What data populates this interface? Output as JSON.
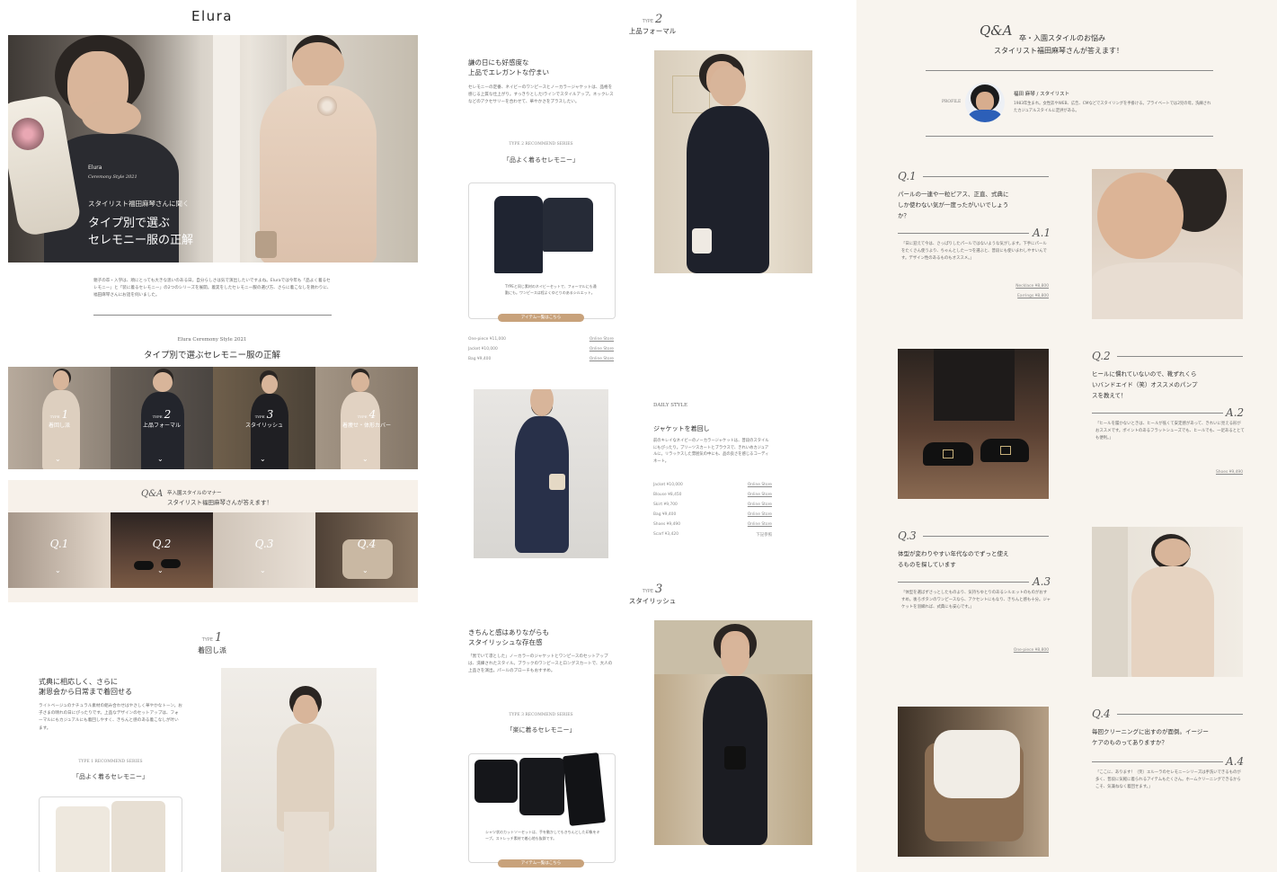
{
  "brand": {
    "logo": "Elura"
  },
  "hero": {
    "overlay_brand": "Elura",
    "overlay_sub": "Ceremony Style 2021",
    "overlay_kicker": "スタイリスト福田麻琴さんに聞く",
    "overlay_title_line1": "タイプ別で選ぶ",
    "overlay_title_line2": "セレモニー服の正解"
  },
  "intro_text": "親子の卒・入学は、頑にとっても大きな思いのある日。自分らしさは気で演出したいですよね。Eluraでは今年も「品よく着るセレモニー」と「装に着るセレモニー」の2つのシリーズを展開。着実をしたセレモニー服の選び方、さらに着こなしを教わりに、福田麻琴さんにお話を伺いました。",
  "section_en": "Elura Ceremony Style 2021",
  "section_title": "タイプ別で選ぶセレモニー服の正解",
  "type_tiles": [
    {
      "prefix": "TYPE",
      "num": "1",
      "label": "着回し派"
    },
    {
      "prefix": "TYPE",
      "num": "2",
      "label": "上品フォーマル"
    },
    {
      "prefix": "TYPE",
      "num": "3",
      "label": "スタイリッシュ"
    },
    {
      "prefix": "TYPE",
      "num": "4",
      "label": "着痩せ・体形カバー"
    }
  ],
  "qa_banner": {
    "logo": "Q&A",
    "line1": "卒入園スタイルのマナー",
    "line2": "スタイリスト福田麻琴さんが答えます！"
  },
  "qa_tiles": [
    "Q.1",
    "Q.2",
    "Q.3",
    "Q.4"
  ],
  "type1": {
    "prefix": "TYPE",
    "num": "1",
    "title": "着回し派",
    "heading1": "式典に相応しく、さらに",
    "heading2": "謝恩会から日常まで着回せる",
    "body": "ライトベージュのナチュラル素材の組み合わせはやさしく華やかなトーン。お子さまの晴れの日にぴったりです。上品なデザインのセットアップは、フォーマルにもカジュアルにも着回しやすく、きちんと感のある着こなしが叶います。",
    "recommend": "TYPE 1 RECOMMEND SERIES",
    "series": "「品よく着るセレモニー」"
  },
  "type2": {
    "prefix": "TYPE",
    "num": "2",
    "title": "上品フォーマル",
    "heading1": "謙の日にも好感度な",
    "heading2": "上品でエレガントな佇まい",
    "body": "セレモニーの定番、ネイビーのワンピースとノーカラージャケットは、品格を感じる上質な仕上がり。すっきりとしたIラインでスタイルアップ。ネックレスなどのアクセサリーを合わせて、華やかさをプラスしたい。",
    "recommend": "TYPE 2 RECOMMEND SERIES",
    "series": "「品よく着るセレモニー」",
    "product_caption": "TYPEと同じ素材のネイビーセットで、フォーマルにも通勤にも。ワンピースは程よくゆとりのあるシルエット。",
    "cta": "アイテム一覧はこちら",
    "items": [
      {
        "name": "One-piece ¥11,000",
        "link": "Online Store"
      },
      {
        "name": "Jacket ¥10,000",
        "link": "Online Store"
      },
      {
        "name": "Bag ¥9,400",
        "link": "Online Store"
      }
    ],
    "daily_en": "DAILY STYLE",
    "daily_title": "ジャケットを着回し",
    "daily_body": "前のキレイなネイビーのノーカラージャケットは、普段のスタイルにもぴったり。プリーツスカートとブラウスで、きれいめカジュアルに。リラックスした雰囲気の中にも、品の良さを感じるコーディネート。",
    "daily_items": [
      {
        "name": "Jacket ¥10,000",
        "link": "Online Store"
      },
      {
        "name": "Blouse ¥8,450",
        "link": "Online Store"
      },
      {
        "name": "Skirt ¥9,700",
        "link": "Online Store"
      },
      {
        "name": "Bag ¥9,400",
        "link": "Online Store"
      },
      {
        "name": "Shoes ¥9,490",
        "link": "Online Store"
      },
      {
        "name": "Scarf ¥3,420",
        "link": "下記参照"
      }
    ]
  },
  "type3": {
    "prefix": "TYPE",
    "num": "3",
    "title": "スタイリッシュ",
    "heading1": "きちんと感はありながらも",
    "heading2": "スタイリッシュな存在感",
    "body": "「黒でいて凛とした」ノーカラーのジャケットとワンピースのセットアップは、洗練されたスタイル。ブラックのワンピースとロングスカートで、大人の上品さを演出。パールのブローチもおすすめ。",
    "recommend": "TYPE 3 RECOMMEND SERIES",
    "series": "「楽に着るセレモニー」",
    "product_caption": "シャツ状のカットソーセットは、手を動かしてもきちんとした印象をキープ。ストレッチ素材で着心地も抜群です。",
    "cta": "アイテム一覧はこちら"
  },
  "qa": {
    "logo": "Q&A",
    "title1": "卒・入園スタイルのお悩み",
    "title2": "スタイリスト福田麻琴さんが答えます！",
    "profile_label": "PROFILE",
    "profile_name": "福田 麻琴 / スタイリスト",
    "profile_text": "1983年生まれ。女性誌やWEB、広告、CMなどでスタイリングを手掛ける。プライベートでは2児の母。洗練されたカジュアルスタイルに定評がある。",
    "items": [
      {
        "q_label": "Q.1",
        "a_label": "A.1",
        "question": "パールの一連や一粒ピアス、正直、式典にしか使わない気が一度ったがいいでしょうか？",
        "answer": "「日に迎えて今は、さっぱりしたパールではないような気がします。下手にパールをたくさん使うより、ちゃんとした一つを選ぶと、普段にも使いまわしやすいんです。デザイン性のあるものもオススメ。」",
        "links": [
          "Necklace ¥8,800",
          "Earrings ¥8,800"
        ]
      },
      {
        "q_label": "Q.2",
        "a_label": "A.2",
        "question": "ヒールに慣れていないので、靴ずれくらいバンドエイド（笑）オススメのパンプスを教えて！",
        "answer": "「ヒールを履かないときは、ヒールが低くて安定感があって、きれいに見える形がおススメです。ポイントのあるフラットシューズでも、ヒールでも、一足あるととても便利。」",
        "links": [
          "Shoes ¥9,490"
        ]
      },
      {
        "q_label": "Q.3",
        "a_label": "A.3",
        "question": "体型が変わりやすい年代なのでずっと使えるものを探しています",
        "answer": "「体型を選ばずさっとしたものより、気持ちゆとりのあるシルエットのものがおすすめ。後ろボタンのワンピースなら、アクセントにもなり、きちんと感も十分。ジャケットを羽織れば、式典にも安心です。」",
        "links": [
          "One-piece ¥8,800"
        ]
      },
      {
        "q_label": "Q.4",
        "a_label": "A.4",
        "question": "毎回クリーニングに出すのが面倒。イージーケアのものってありますか？",
        "answer": "「ここに、あります！（笑）エルーラのセレモニーシリーズは手洗いできるものが多く、普段に気軽に着られるアイテムもたくさん。ホームクリーニングできるからこそ、気兼ねなく着回せます。」",
        "links": []
      }
    ]
  }
}
